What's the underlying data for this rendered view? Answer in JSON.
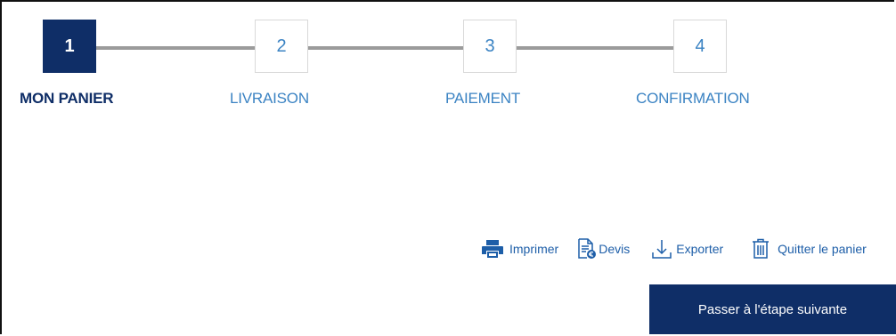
{
  "stepper": {
    "steps": [
      {
        "number": "1",
        "label": "MON PANIER",
        "active": true
      },
      {
        "number": "2",
        "label": "LIVRAISON",
        "active": false
      },
      {
        "number": "3",
        "label": "PAIEMENT",
        "active": false
      },
      {
        "number": "4",
        "label": "CONFIRMATION",
        "active": false
      }
    ]
  },
  "actions": {
    "print_label": "Imprimer",
    "quote_label": "Devis",
    "export_label": "Exporter",
    "quit_label": "Quitter le panier"
  },
  "next_button_label": "Passer à l'étape suivante",
  "colors": {
    "primary_navy": "#0f2e67",
    "accent_blue": "#3b83c3",
    "connector_gray": "#9b9b9b"
  },
  "icons": {
    "print": "printer-icon",
    "quote": "quote-document-icon",
    "export": "download-icon",
    "quit": "trash-icon"
  }
}
